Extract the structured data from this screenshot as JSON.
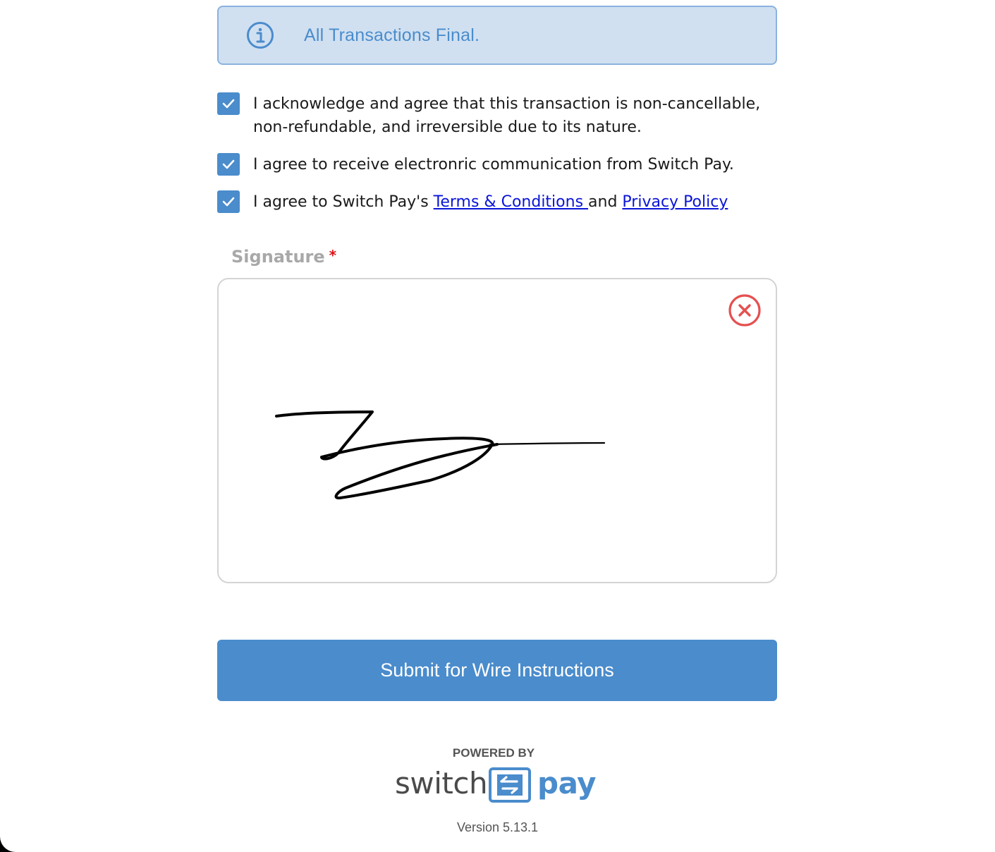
{
  "banner": {
    "icon": "info-icon",
    "text": "All Transactions Final."
  },
  "agreements": [
    {
      "checked": true,
      "text": "I acknowledge and agree that this transaction is non-cancellable, non-refundable, and irreversible due to its nature."
    },
    {
      "checked": true,
      "text": "I agree to receive electronric communication from Switch Pay."
    },
    {
      "checked": true,
      "prefix": "I agree to Switch Pay's ",
      "terms_link": "Terms & Conditions ",
      "middle": "and ",
      "privacy_link": "Privacy Policy"
    }
  ],
  "signature": {
    "label": "Signature",
    "required_mark": "*",
    "clear_icon": "close-circle-icon"
  },
  "submit_label": "Submit for Wire Instructions",
  "footer": {
    "powered_by": "POWERED BY",
    "logo_switch": "switch",
    "logo_pay": "pay",
    "logo_icon": "swap-arrows-icon",
    "version": "Version 5.13.1"
  },
  "colors": {
    "accent": "#4a8ccc",
    "banner_bg": "#d0e0f1",
    "link": "#0a14d8",
    "clear_icon": "#e55050",
    "required": "#e01010"
  }
}
